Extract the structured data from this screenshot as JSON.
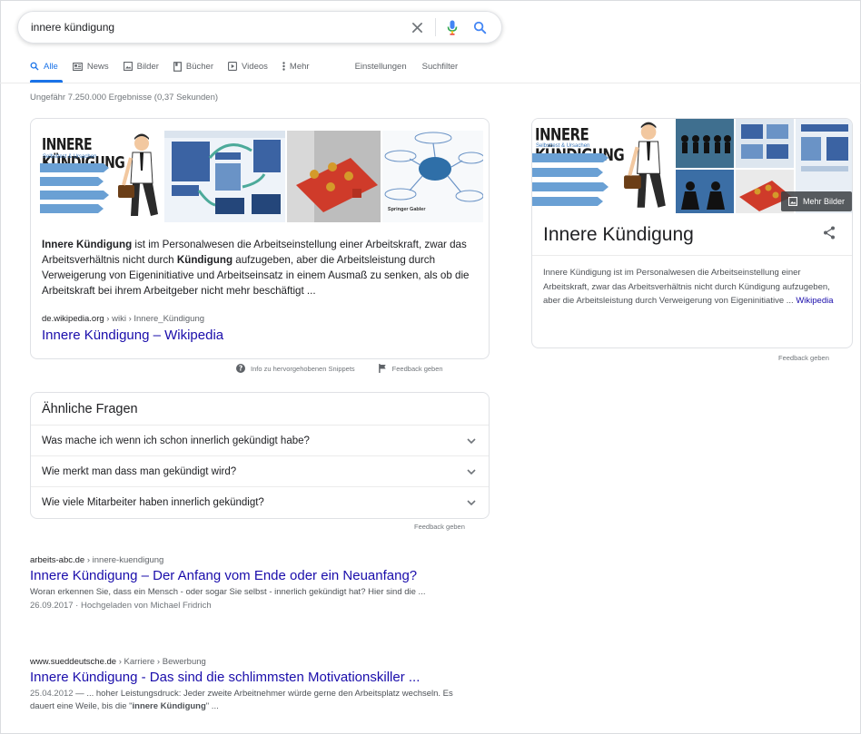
{
  "search": {
    "query": "innere kündigung"
  },
  "tabs": [
    {
      "label": "Alle",
      "icon": "search-icon"
    },
    {
      "label": "News",
      "icon": "news-icon"
    },
    {
      "label": "Bilder",
      "icon": "image-icon"
    },
    {
      "label": "Bücher",
      "icon": "book-icon"
    },
    {
      "label": "Videos",
      "icon": "video-icon"
    },
    {
      "label": "Mehr",
      "icon": "more-vert-icon"
    }
  ],
  "tools": {
    "settings": "Einstellungen",
    "filter": "Suchfilter"
  },
  "stats": "Ungefähr 7.250.000 Ergebnisse (0,37 Sekunden)",
  "featured": {
    "image1_heading": "INNERE KÜNDIGUNG",
    "image1_sub": "Selbsttest & Ursachen",
    "image4_brand": "Springer Gabler",
    "snippet_b1": "Innere Kündigung",
    "snippet_t1": " ist im Personalwesen die Arbeitseinstellung einer Arbeitskraft, zwar das Arbeitsverhältnis nicht durch ",
    "snippet_b2": "Kündigung",
    "snippet_t2": " aufzugeben, aber die Arbeitsleistung durch Verweigerung von Eigeninitiative und Arbeitseinsatz in einem Ausmaß zu senken, als ob die Arbeitskraft bei ihrem Arbeitgeber nicht mehr beschäftigt ...",
    "cite_domain": "de.wikipedia.org",
    "cite_path": " › wiki › Innere_Kündigung",
    "title": "Innere Kündigung – Wikipedia",
    "info_label": "Info zu hervorgehobenen Snippets",
    "feedback": "Feedback geben"
  },
  "paa": {
    "heading": "Ähnliche Fragen",
    "questions": [
      "Was mache ich wenn ich schon innerlich gekündigt habe?",
      "Wie merkt man dass man gekündigt wird?",
      "Wie viele Mitarbeiter haben innerlich gekündigt?"
    ],
    "feedback": "Feedback geben"
  },
  "results": [
    {
      "domain": "arbeits-abc.de",
      "path": " › innere-kuendigung",
      "title": "Innere Kündigung – Der Anfang vom Ende oder ein Neuanfang?",
      "desc": "Woran erkennen Sie, dass ein Mensch - oder sogar Sie selbst - innerlich gekündigt hat? Hier sind die ...",
      "meta": "26.09.2017 · Hochgeladen von Michael Fridrich"
    },
    {
      "domain": "www.sueddeutsche.de",
      "path": " › Karriere › Bewerbung",
      "title": "Innere Kündigung - Das sind die schlimmsten Motivationskiller ...",
      "date": "25.04.2012",
      "desc_pre": " — ... hoher Leistungsdruck: Jeder zweite Arbeitnehmer würde gerne den Arbeitsplatz wechseln. Es dauert eine Weile, bis die \"",
      "desc_bold": "innere Kündigung",
      "desc_post": "\" ..."
    }
  ],
  "knowledge_panel": {
    "image_heading": "INNERE KÜNDIGUNG",
    "image_sub": "Selbsttest & Ursachen",
    "more_images": "Mehr Bilder",
    "title": "Innere Kündigung",
    "desc": "Innere Kündigung ist im Personalwesen die Arbeitseinstellung einer Arbeitskraft, zwar das Arbeitsverhältnis nicht durch Kündigung aufzugeben, aber die Arbeitsleistung durch Verweigerung von Eigeninitiative ... ",
    "source": "Wikipedia",
    "feedback": "Feedback geben"
  },
  "colors": {
    "link": "#1a0dab",
    "accent": "#1a73e8",
    "text": "#202124",
    "muted": "#70757a"
  }
}
